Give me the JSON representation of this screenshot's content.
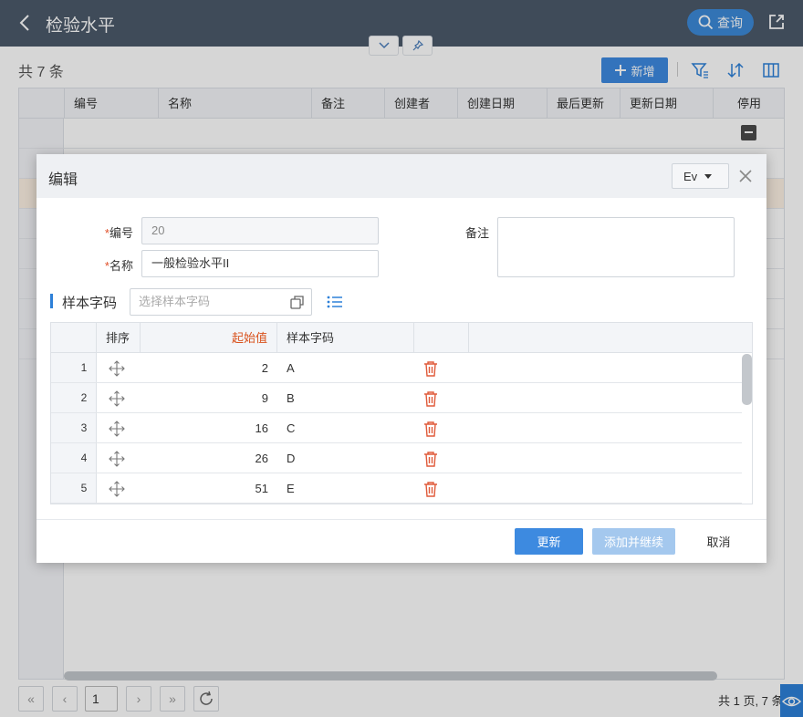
{
  "header": {
    "title": "检验水平",
    "search_label": "查询"
  },
  "toolbar": {
    "total_count": "共 7 条",
    "add_label": "新增"
  },
  "grid": {
    "columns": [
      "编号",
      "名称",
      "备注",
      "创建者",
      "创建日期",
      "最后更新",
      "更新日期",
      "停用"
    ]
  },
  "pagination": {
    "current_page": "1",
    "summary": "共 1 页, 7 条"
  },
  "dialog": {
    "title": "编辑",
    "language": "Ev",
    "fields": {
      "code_label": "编号",
      "code_value": "20",
      "name_label": "名称",
      "name_value": "一般检验水平II",
      "remark_label": "备注",
      "required_mark": "*"
    },
    "sample_section": {
      "title": "样本字码",
      "picker_placeholder": "选择样本字码",
      "columns": {
        "sort": "排序",
        "start": "起始值",
        "code": "样本字码"
      },
      "rows": [
        {
          "num": "1",
          "start": "2",
          "code": "A"
        },
        {
          "num": "2",
          "start": "9",
          "code": "B"
        },
        {
          "num": "3",
          "start": "16",
          "code": "C"
        },
        {
          "num": "4",
          "start": "26",
          "code": "D"
        },
        {
          "num": "5",
          "start": "51",
          "code": "E"
        }
      ]
    },
    "buttons": {
      "update": "更新",
      "add_continue": "添加并继续",
      "cancel": "取消"
    }
  },
  "colors": {
    "topbar": "#4c5a6b",
    "primary": "#3d8ae0",
    "accent_orange": "#d9531e",
    "trash": "#e05a3a"
  }
}
